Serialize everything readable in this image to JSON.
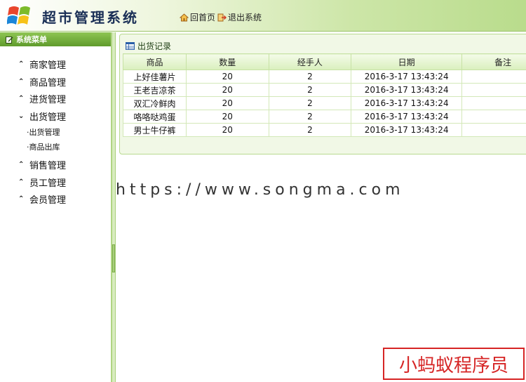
{
  "header": {
    "title": "超市管理系统",
    "home_label": "回首页",
    "logout_label": "退出系统"
  },
  "sidebar": {
    "heading": "系统菜单",
    "items": [
      {
        "label": "商家管理",
        "state": "collapsed"
      },
      {
        "label": "商品管理",
        "state": "collapsed"
      },
      {
        "label": "进货管理",
        "state": "collapsed"
      },
      {
        "label": "出货管理",
        "state": "expanded"
      },
      {
        "label": "销售管理",
        "state": "collapsed"
      },
      {
        "label": "员工管理",
        "state": "collapsed"
      },
      {
        "label": "会员管理",
        "state": "collapsed"
      }
    ],
    "subitems": [
      "·出货管理",
      "·商品出库"
    ]
  },
  "panel": {
    "title": "出货记录",
    "columns": [
      "商品",
      "数量",
      "经手人",
      "日期",
      "备注"
    ],
    "rows": [
      [
        "上好佳薯片",
        "20",
        "2",
        "2016-3-17 13:43:24",
        ""
      ],
      [
        "王老吉凉茶",
        "20",
        "2",
        "2016-3-17 13:43:24",
        ""
      ],
      [
        "双汇冷鲜肉",
        "20",
        "2",
        "2016-3-17 13:43:24",
        ""
      ],
      [
        "咯咯哒鸡蛋",
        "20",
        "2",
        "2016-3-17 13:43:24",
        ""
      ],
      [
        "男士牛仔裤",
        "20",
        "2",
        "2016-3-17 13:43:24",
        ""
      ]
    ]
  },
  "watermark": {
    "url": "https://www.songma.com",
    "brand": "小蚂蚁程序员"
  },
  "icons": {
    "logo": "windows-flag-icon",
    "home": "home-icon",
    "logout": "exit-icon",
    "menu": "edit-icon",
    "collapsed": "chevron-up-double-icon",
    "expanded": "chevron-down-double-icon",
    "table": "table-icon"
  },
  "colors": {
    "accent_green": "#5f9b2c",
    "header_title": "#1a2f56",
    "brand_red": "#d62525"
  }
}
